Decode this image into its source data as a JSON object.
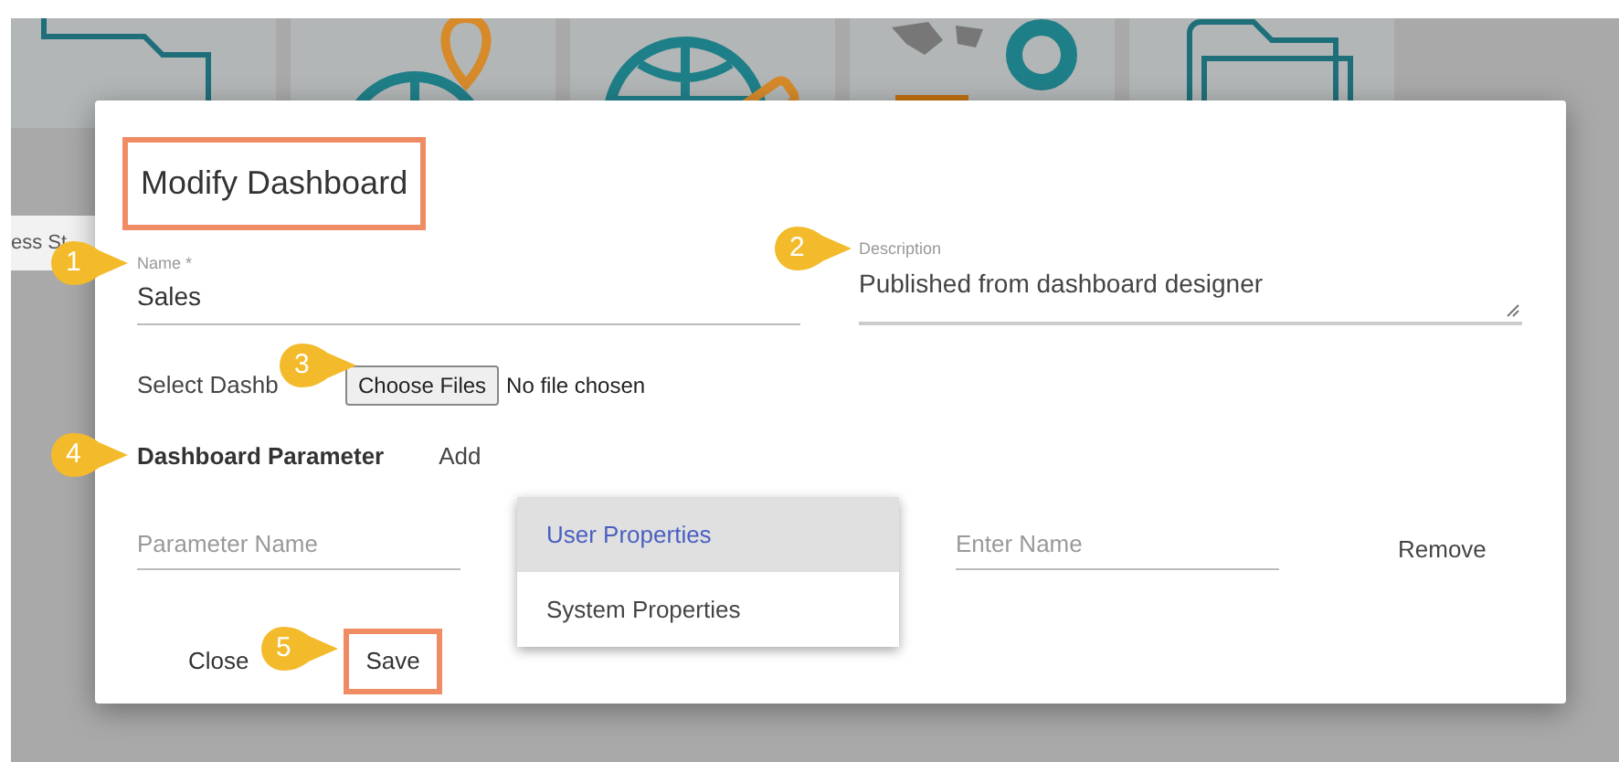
{
  "background": {
    "partial_text": "ess St"
  },
  "dialog": {
    "title": "Modify Dashboard",
    "title_highlighted": true,
    "name_field": {
      "label": "Name *",
      "value": "Sales"
    },
    "description_field": {
      "label": "Description",
      "value": "Published from dashboard designer"
    },
    "file_picker": {
      "label": "Select Dashb",
      "button": "Choose Files",
      "status": "No file chosen"
    },
    "parameter_section": {
      "title": "Dashboard Parameter",
      "add": "Add"
    },
    "parameter_row": {
      "name_placeholder": "Parameter Name",
      "value_placeholder": "Enter Name",
      "remove": "Remove"
    },
    "property_menu": [
      {
        "label": "User Properties",
        "selected": true
      },
      {
        "label": "System Properties",
        "selected": false
      }
    ],
    "buttons": [
      {
        "label": "Close",
        "highlighted": false
      },
      {
        "label": "Save",
        "highlighted": true
      }
    ]
  },
  "callouts": [
    "1",
    "2",
    "3",
    "4",
    "5"
  ]
}
